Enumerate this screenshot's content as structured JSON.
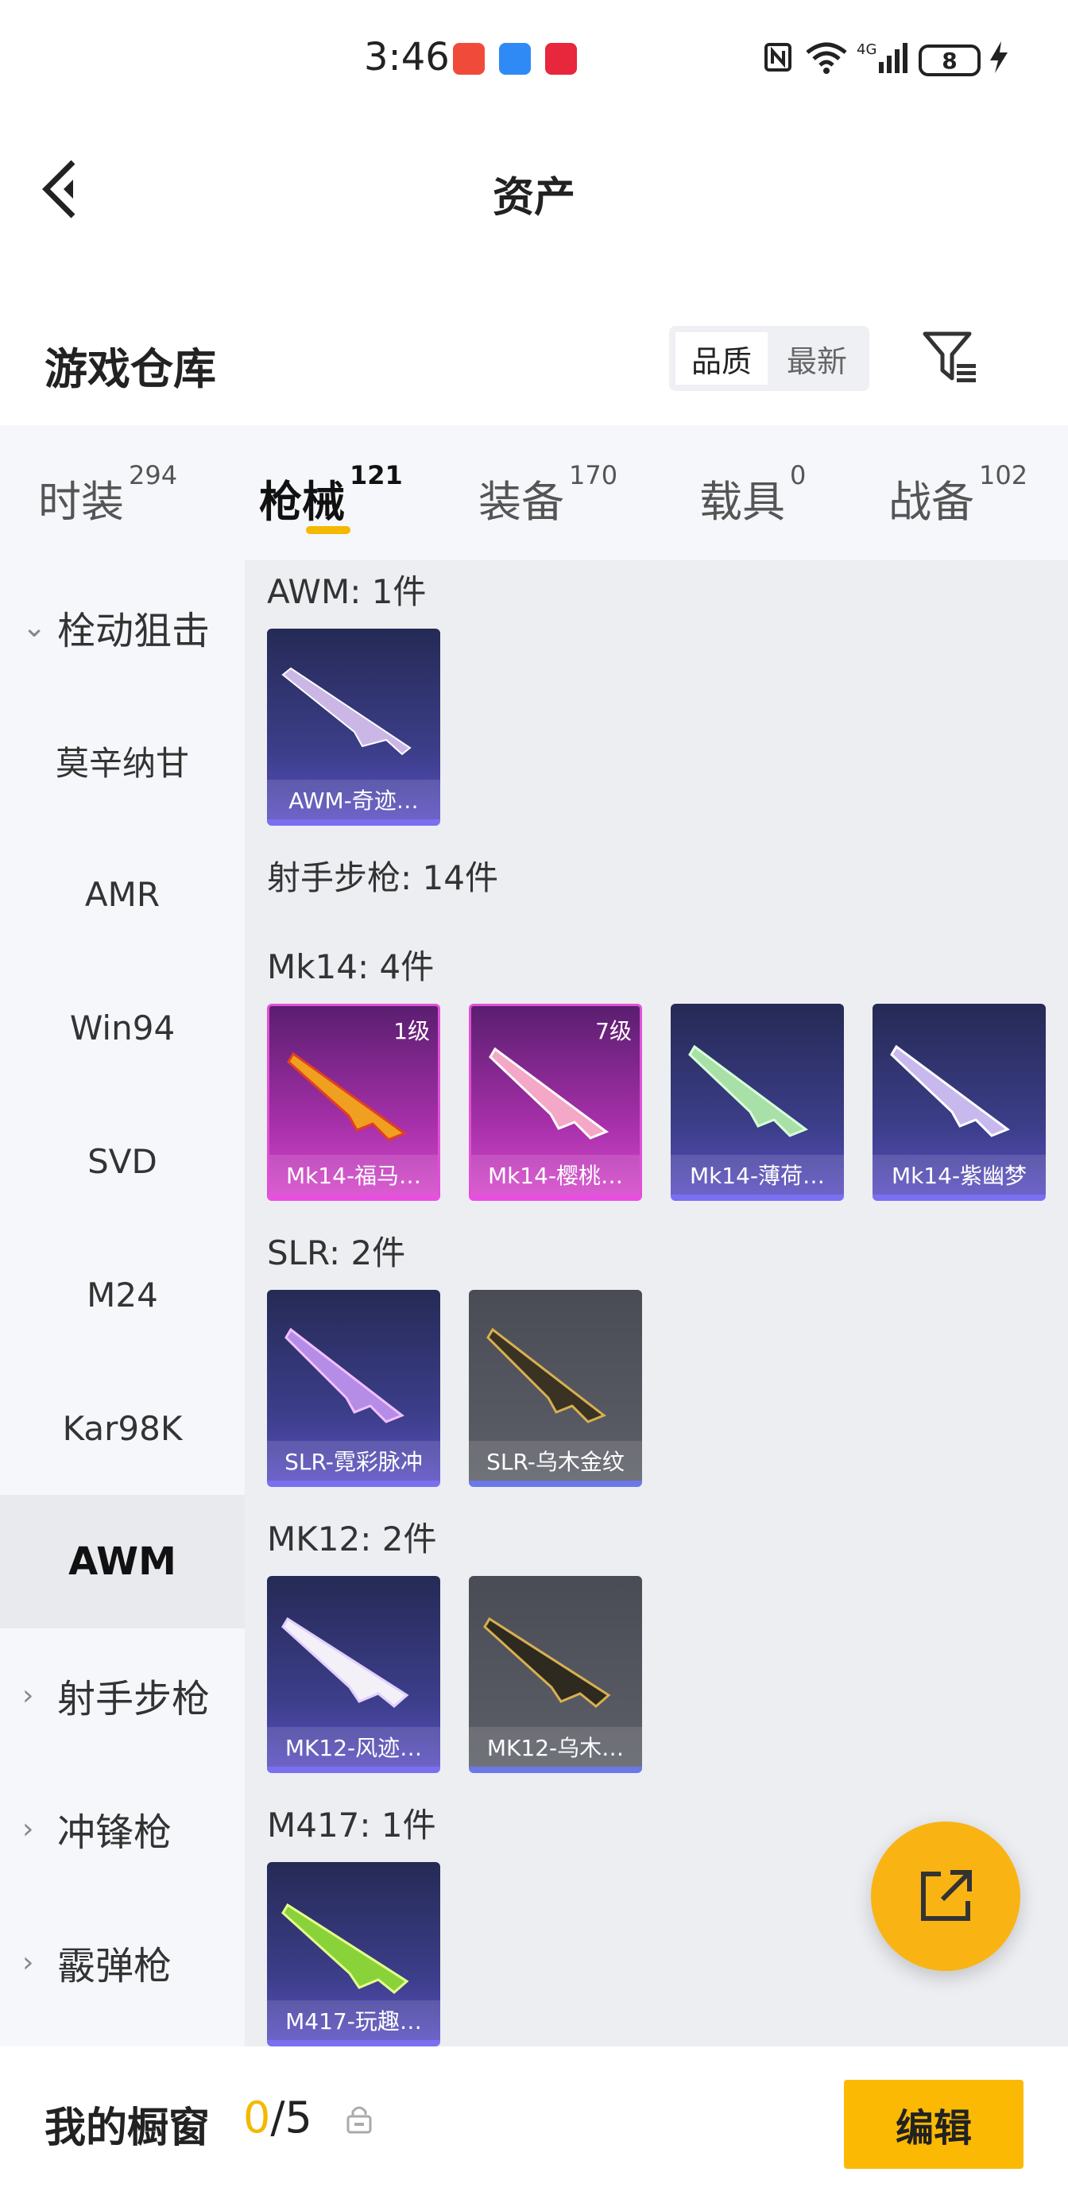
{
  "status_bar": {
    "time": "3:46",
    "battery": "8"
  },
  "nav": {
    "title": "资产"
  },
  "header": {
    "title": "游戏仓库",
    "sort_quality": "品质",
    "sort_newest": "最新"
  },
  "tabs": [
    {
      "label": "时装",
      "count": "294"
    },
    {
      "label": "枪械",
      "count": "121"
    },
    {
      "label": "装备",
      "count": "170"
    },
    {
      "label": "载具",
      "count": "0"
    },
    {
      "label": "战备",
      "count": "102"
    }
  ],
  "sidebar": {
    "group_open": "栓动狙击",
    "items": [
      "莫辛纳甘",
      "AMR",
      "Win94",
      "SVD",
      "M24",
      "Kar98K",
      "AWM"
    ],
    "groups_closed": [
      "射手步枪",
      "冲锋枪",
      "霰弹枪"
    ]
  },
  "sections": {
    "awm": {
      "title": "AWM: 1件",
      "cards": [
        "AWM-奇迹…"
      ]
    },
    "marksman": {
      "title": "射手步枪: 14件"
    },
    "mk14": {
      "title": "Mk14: 4件",
      "cards": [
        "Mk14-福马…",
        "Mk14-樱桃…",
        "Mk14-薄荷…",
        "Mk14-紫幽梦"
      ],
      "levels": [
        "1级",
        "7级"
      ]
    },
    "slr": {
      "title": "SLR: 2件",
      "cards": [
        "SLR-霓彩脉冲",
        "SLR-乌木金纹"
      ]
    },
    "mk12": {
      "title": "MK12: 2件",
      "cards": [
        "MK12-风迹…",
        "MK12-乌木…"
      ]
    },
    "m417": {
      "title": "M417: 1件",
      "cards": [
        "M417-玩趣…"
      ]
    }
  },
  "bottom": {
    "label": "我的橱窗",
    "count_current": "0",
    "count_total": "/5",
    "edit": "编辑"
  },
  "colors": {
    "accent": "#f9b413",
    "purple_rarity": "#7a6ff0",
    "pink_rarity": "#e94ee0"
  },
  "icons": [
    "back-arrow-icon",
    "filter-icon",
    "lock-icon",
    "share-external-icon"
  ]
}
